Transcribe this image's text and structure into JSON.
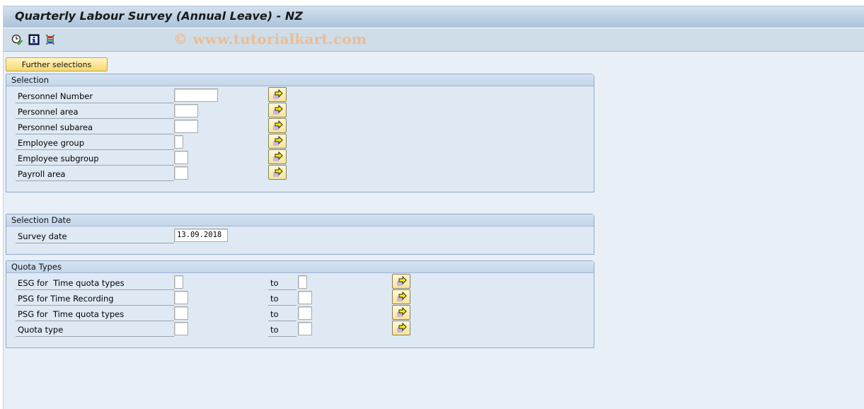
{
  "window": {
    "title": "Quarterly Labour Survey (Annual Leave) - NZ",
    "watermark": "© www.tutorialkart.com"
  },
  "toolbar": {
    "icons": [
      "execute-clock-icon",
      "info-icon",
      "selection-screen-icon"
    ]
  },
  "further_selections_label": "Further selections",
  "selection": {
    "header": "Selection",
    "rows": [
      {
        "label": "Personnel Number",
        "value": ""
      },
      {
        "label": "Personnel area",
        "value": ""
      },
      {
        "label": "Personnel subarea",
        "value": ""
      },
      {
        "label": "Employee group",
        "value": ""
      },
      {
        "label": "Employee subgroup",
        "value": ""
      },
      {
        "label": "Payroll area",
        "value": ""
      }
    ]
  },
  "selection_date": {
    "header": "Selection Date",
    "survey_date_label": "Survey date",
    "survey_date_value": "13.09.2018"
  },
  "quota_types": {
    "header": "Quota Types",
    "to_label": "to",
    "rows": [
      {
        "label": "ESG for  Time quota types",
        "from": "",
        "to": ""
      },
      {
        "label": "PSG for Time Recording",
        "from": "",
        "to": ""
      },
      {
        "label": "PSG for  Time quota types",
        "from": "",
        "to": ""
      },
      {
        "label": "Quota type",
        "from": "",
        "to": ""
      }
    ]
  },
  "colors": {
    "button_yellow": "#f6d970",
    "group_border": "#8faac8",
    "background": "#e8eff7"
  }
}
